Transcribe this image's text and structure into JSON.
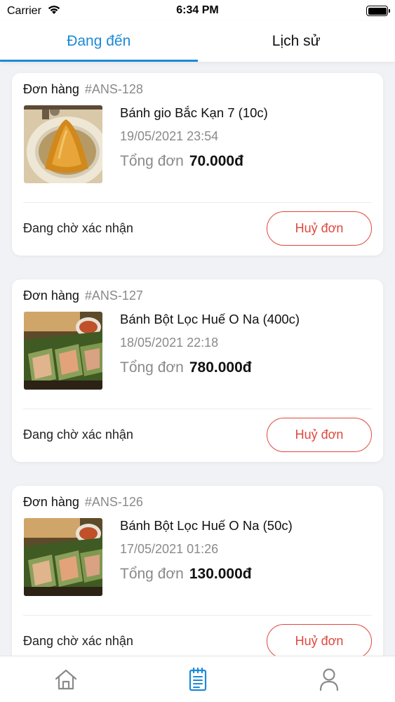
{
  "status_bar": {
    "carrier": "Carrier",
    "time": "6:34 PM"
  },
  "tabs": [
    {
      "label": "Đang đến",
      "active": true
    },
    {
      "label": "Lịch sử",
      "active": false
    }
  ],
  "orders": [
    {
      "order_label": "Đơn hàng",
      "code": "#ANS-128",
      "name": "Bánh gio Bắc Kạn 7 (10c)",
      "date": "19/05/2021 23:54",
      "total_label": "Tổng đơn",
      "total_value": "70.000đ",
      "status": "Đang chờ xác nhận",
      "cancel_label": "Huỷ đơn",
      "image_icon": "banh-gio-photo"
    },
    {
      "order_label": "Đơn hàng",
      "code": "#ANS-127",
      "name": "Bánh Bột Lọc Huế O Na (400c)",
      "date": "18/05/2021 22:18",
      "total_label": "Tổng đơn",
      "total_value": "780.000đ",
      "status": "Đang chờ xác nhận",
      "cancel_label": "Huỷ đơn",
      "image_icon": "banh-bot-loc-photo"
    },
    {
      "order_label": "Đơn hàng",
      "code": "#ANS-126",
      "name": "Bánh Bột Lọc Huế O Na (50c)",
      "date": "17/05/2021 01:26",
      "total_label": "Tổng đơn",
      "total_value": "130.000đ",
      "status": "Đang chờ xác nhận",
      "cancel_label": "Huỷ đơn",
      "image_icon": "banh-bot-loc-photo"
    }
  ],
  "bottom_nav": [
    {
      "icon": "home-icon",
      "active": false
    },
    {
      "icon": "orders-icon",
      "active": true
    },
    {
      "icon": "profile-icon",
      "active": false
    }
  ],
  "colors": {
    "accent": "#1c8ad6",
    "cancel": "#e0483d",
    "muted_text": "#8a8a8a",
    "background": "#f1f2f6"
  }
}
